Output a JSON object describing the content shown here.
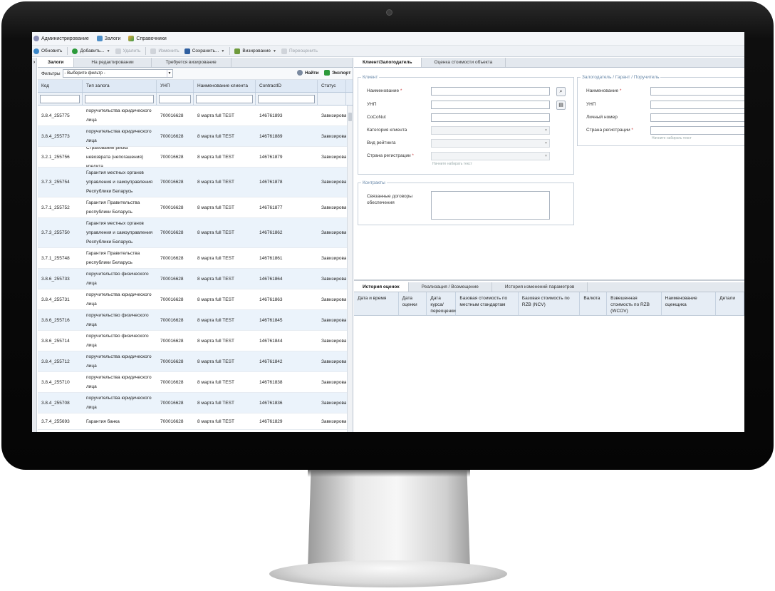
{
  "menubar": {
    "items": [
      {
        "label": "Администрирование",
        "icon": "gear-icon"
      },
      {
        "label": "Залоги",
        "icon": "building-icon"
      },
      {
        "label": "Справочники",
        "icon": "book-icon"
      }
    ]
  },
  "toolbar": {
    "refresh": "Обновить",
    "add": "Добавить...",
    "delete": "Удалить",
    "edit": "Изменить",
    "save": "Сохранить...",
    "approve": "Визирование",
    "reassign": "Переоценить"
  },
  "left": {
    "tabs": [
      "Залоги",
      "На редактировании",
      "Требуется визирование"
    ],
    "filter_label": "Фильтры",
    "filter_value": "- Выберите фильтр -",
    "find": "Найти",
    "export": "Экспорт",
    "columns": [
      "Код",
      "Тип залога",
      "УНП",
      "Наименование клиента",
      "ContractID",
      "Статус"
    ],
    "rows": [
      [
        "3.8.4_255775",
        "поручительства юридического лица",
        "700016628",
        "8 марта full TEST",
        "146761893",
        "Завизирова"
      ],
      [
        "3.8.4_255773",
        "поручительства юридического лица",
        "700016628",
        "8 марта full TEST",
        "146761889",
        "Завизирова"
      ],
      [
        "3.2.1_255756",
        "Страхование риска невозврата (непогашения) кредита",
        "700016628",
        "8 марта full TEST",
        "146761879",
        "Завизирова"
      ],
      [
        "3.7.3_255754",
        "Гарантия местных органов управления и самоуправления Республики Беларусь",
        "700016628",
        "8 марта full TEST",
        "146761878",
        "Завизирова"
      ],
      [
        "3.7.1_255752",
        "Гарантия Правительства республики Беларусь",
        "700016628",
        "8 марта full TEST",
        "146761877",
        "Завизирова"
      ],
      [
        "3.7.3_255750",
        "Гарантия местных органов управления и самоуправления Республики Беларусь",
        "700016628",
        "8 марта full TEST",
        "146761862",
        "Завизирова"
      ],
      [
        "3.7.1_255748",
        "Гарантия Правительства республики Беларусь",
        "700016628",
        "8 марта full TEST",
        "146761861",
        "Завизирова"
      ],
      [
        "3.8.6_255733",
        "поручительство физического лица",
        "700016628",
        "8 марта full TEST",
        "146761864",
        "Завизирова"
      ],
      [
        "3.8.4_255731",
        "поручительства юридического лица",
        "700016628",
        "8 марта full TEST",
        "146761863",
        "Завизирова"
      ],
      [
        "3.8.6_255716",
        "поручительство физического лица",
        "700016628",
        "8 марта full TEST",
        "146761845",
        "Завизирова"
      ],
      [
        "3.8.6_255714",
        "поручительство физического лица",
        "700016628",
        "8 марта full TEST",
        "146761844",
        "Завизирова"
      ],
      [
        "3.8.4_255712",
        "поручительства юридического лица",
        "700016628",
        "8 марта full TEST",
        "146761842",
        "Завизирова"
      ],
      [
        "3.8.4_255710",
        "поручительства юридического лица",
        "700016628",
        "8 марта full TEST",
        "146761838",
        "Завизирова"
      ],
      [
        "3.8.4_255708",
        "поручительства юридического лица",
        "700016628",
        "8 марта full TEST",
        "146761836",
        "Завизирова"
      ],
      [
        "3.7.4_255693",
        "Гарантия банка",
        "700016628",
        "8 марта full TEST",
        "146761829",
        "Завизирова"
      ]
    ]
  },
  "right": {
    "tabs": [
      "Клиент/Залогодатель",
      "Оценка стоимости объекта"
    ],
    "client": {
      "legend": "Клиент",
      "name": "Наименование",
      "unp": "УНП",
      "coconut": "CoCoNut",
      "category": "Категория клиента",
      "rating": "Вид рейтинга",
      "country": "Страна регистрации",
      "hint": "Начните набирать текст"
    },
    "pledger": {
      "legend": "Залогодатель / Гарант / Поручитель",
      "name": "Наименование",
      "unp": "УНП",
      "personal": "Личный номер",
      "country": "Страна регистрации",
      "hint": "Начните набирать текст"
    },
    "contracts": {
      "legend": "Контракты",
      "linked": "Связанные договоры обеспечения"
    },
    "bottom_tabs": [
      "История оценок",
      "Реализация / Возмещение",
      "История изменений параметров"
    ],
    "bottom_columns": [
      "Дата и время",
      "Дата оценки",
      "Дата курса/ переоценки",
      "Базовая стоимость по местным стандартам",
      "Базовая стоимость по RZB (NCV)",
      "Валюта",
      "Взвешенная стоимость по RZB (WCOV)",
      "Наименование оценщика",
      "Детали"
    ]
  }
}
